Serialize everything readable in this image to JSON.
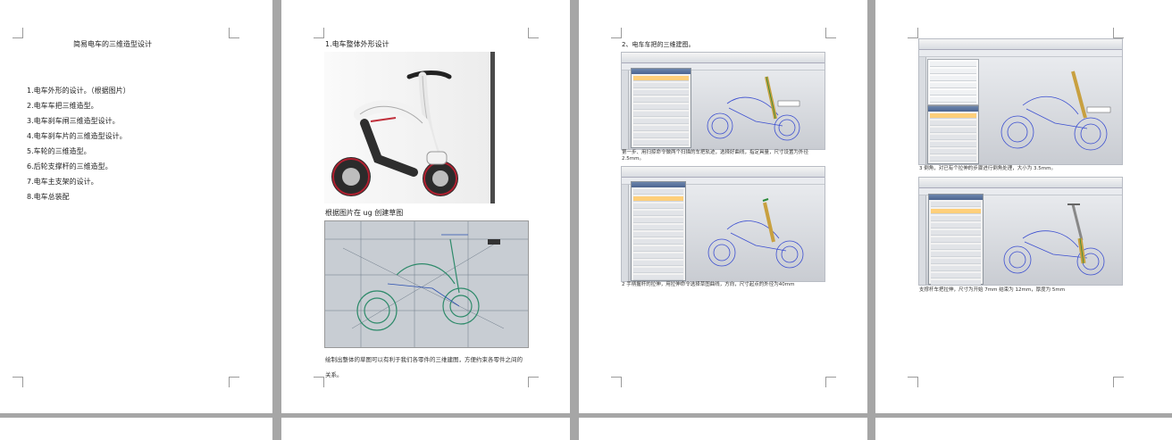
{
  "page1": {
    "title": "简易电车的三维造型设计",
    "items": [
      "1.电车外形的设计。（根据图片）",
      "2.电车车把三维造型。",
      "3.电车刹车闸三维造型设计。",
      "4.电车刹车片的三维造型设计。",
      "5.车轮的三维造型。",
      "6.后轮支撑杆的三维造型。",
      "7.电车主支架的设计。",
      "8.电车总装配"
    ]
  },
  "page2": {
    "heading": "1.电车整体外形设计",
    "caption1": "根据图片在 ug 创建草图",
    "para": "绘制出整体的草图可以有利于我们各零件的三维建图，方便约束各零件之间的关系。"
  },
  "page3": {
    "heading": "2、电车车把的三维建图。",
    "step1": "第一步、用扫掠命令做两个扫描的车把轨迹，选择好曲线，指定具量，尺寸设置为外径2.5mm。",
    "step2": "2 手柄握杆的拉伸，用拉伸命令选择草图曲线，方向，尺寸起点的外径为40mm"
  },
  "page4": {
    "step3": "3 倒角，对已有个拉伸的步骤进行倒角处理，大小为 3.5mm。",
    "step4": "支撑杆车把拉伸，尺寸为开始 7mm   结束为 12mm，厚度为 5mm"
  }
}
